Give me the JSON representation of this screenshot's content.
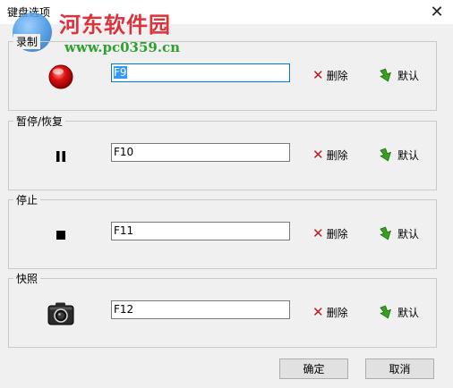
{
  "window": {
    "title": "键盘选项",
    "close_glyph": "✕"
  },
  "watermark": {
    "brand": "河东软件园",
    "url": "www.pc0359.cn"
  },
  "groups": [
    {
      "label": "录制",
      "icon": "record-icon",
      "hotkey": "F9",
      "delete_label": "删除",
      "default_label": "默认"
    },
    {
      "label": "暂停/恢复",
      "icon": "pause-icon",
      "hotkey": "F10",
      "delete_label": "删除",
      "default_label": "默认"
    },
    {
      "label": "停止",
      "icon": "stop-icon",
      "hotkey": "F11",
      "delete_label": "删除",
      "default_label": "默认"
    },
    {
      "label": "快照",
      "icon": "camera-icon",
      "hotkey": "F12",
      "delete_label": "删除",
      "default_label": "默认"
    }
  ],
  "buttons": {
    "ok": "确定",
    "cancel": "取消"
  },
  "colors": {
    "record": "#e01010",
    "delete_x": "#b42020",
    "default_arrow": "#3aa020",
    "focus_border": "#0078d7"
  }
}
